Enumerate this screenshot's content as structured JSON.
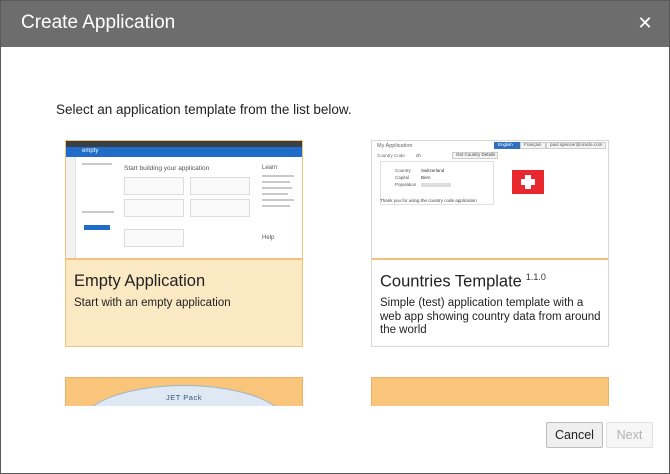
{
  "dialog": {
    "title": "Create Application",
    "close_icon": "close-icon",
    "instruction": "Select an application template from the list below."
  },
  "templates": [
    {
      "name": "Empty Application",
      "version": "",
      "description": "Start with an empty application",
      "selected": true
    },
    {
      "name": "Countries Template",
      "version": "1.1.0",
      "description": "Simple (test) application template with a web app showing country data from around the world",
      "selected": false
    }
  ],
  "partial_templates": [
    {
      "thumb_label": "JET Pack"
    },
    {
      "thumb_label": ""
    }
  ],
  "thumbs": {
    "empty_app": {
      "brand": "empty",
      "heading": "Start building your application",
      "learn": "Learn",
      "help": "Help",
      "create_button": "+ Create application"
    },
    "countries": {
      "app_title": "My Application",
      "tab_english": "English",
      "tab_french": "Français",
      "user": "paul.spencer@oracle.com",
      "code_label": "Country Code",
      "code_value": "ch",
      "get_details": "Get Country Details",
      "country_label": "Country",
      "country_value": "Switzerland",
      "capital_label": "Capital",
      "capital_value": "Bern",
      "population_label": "Population",
      "thanks": "Thank you for using the country code application"
    }
  },
  "buttons": {
    "cancel": "Cancel",
    "next": "Next"
  },
  "colors": {
    "titlebar": "#6d6d6d",
    "selected_card": "#fbe9c4",
    "accent_border": "#f4c07a",
    "flag_red": "#e8282e"
  }
}
